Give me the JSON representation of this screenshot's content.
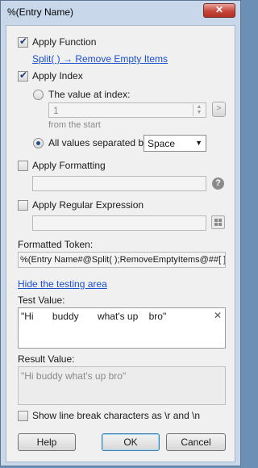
{
  "window": {
    "title": "%(Entry Name)",
    "close_glyph": "✕"
  },
  "apply_function": {
    "label": "Apply Function",
    "checked": true,
    "link": "Split( ) → Remove Empty Items"
  },
  "apply_index": {
    "label": "Apply Index",
    "checked": true,
    "value_at_index_label": "The value at index:",
    "index_value": "1",
    "from_label": "from the  start",
    "all_values_label": "All values separated by:",
    "separator_value": "Space"
  },
  "apply_formatting": {
    "label": "Apply Formatting",
    "checked": false,
    "help_glyph": "?"
  },
  "apply_regex": {
    "label": "Apply Regular Expression",
    "checked": false
  },
  "formatted_token": {
    "label": "Formatted Token:",
    "value": "%(Entry Name#@Split( );RemoveEmptyItems@##[ ]#)"
  },
  "testing": {
    "hide_link": "Hide the testing area",
    "test_label": "Test Value:",
    "test_value": "\"Hi       buddy       what's up    bro\"",
    "clear_glyph": "✕",
    "result_label": "Result Value:",
    "result_value": "\"Hi buddy what's up bro\""
  },
  "line_breaks": {
    "label": "Show line break characters as \\r and \\n",
    "checked": false
  },
  "buttons": {
    "help": "Help",
    "ok": "OK",
    "cancel": "Cancel"
  }
}
